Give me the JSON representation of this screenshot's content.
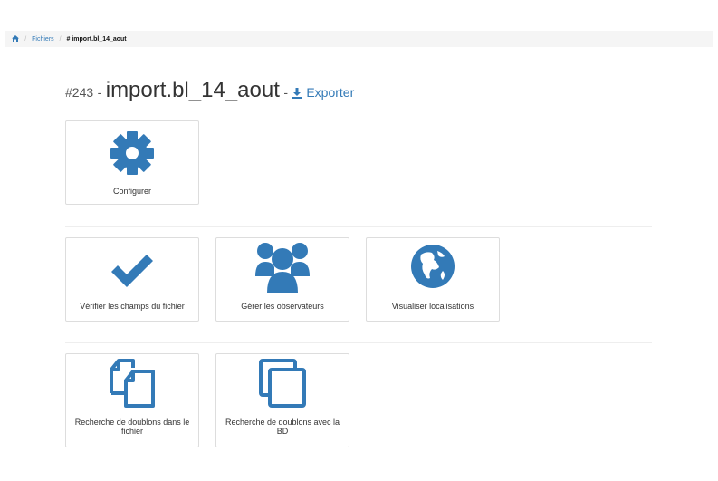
{
  "breadcrumb": {
    "home_icon": "home-icon",
    "items": [
      "Fichiers",
      "# import.bl_14_aout"
    ]
  },
  "header": {
    "number": "#243",
    "dash": "-",
    "name": "import.bl_14_aout",
    "dash2": "-",
    "export_label": "Exporter",
    "export_icon": "download-icon"
  },
  "cards": [
    {
      "label": "Configurer",
      "icon": "gear-icon"
    },
    {
      "label": "Vérifier les champs du fichier",
      "icon": "check-icon"
    },
    {
      "label": "Gérer les observateurs",
      "icon": "users-icon"
    },
    {
      "label": "Visualiser localisations",
      "icon": "globe-icon"
    },
    {
      "label": "Recherche de doublons dans le fichier",
      "icon": "files-icon"
    },
    {
      "label": "Recherche de doublons avec la BD",
      "icon": "copy-icon"
    }
  ],
  "colors": {
    "accent": "#337ab7",
    "border": "#dddddd",
    "breadcrumb_bg": "#f5f5f5"
  }
}
